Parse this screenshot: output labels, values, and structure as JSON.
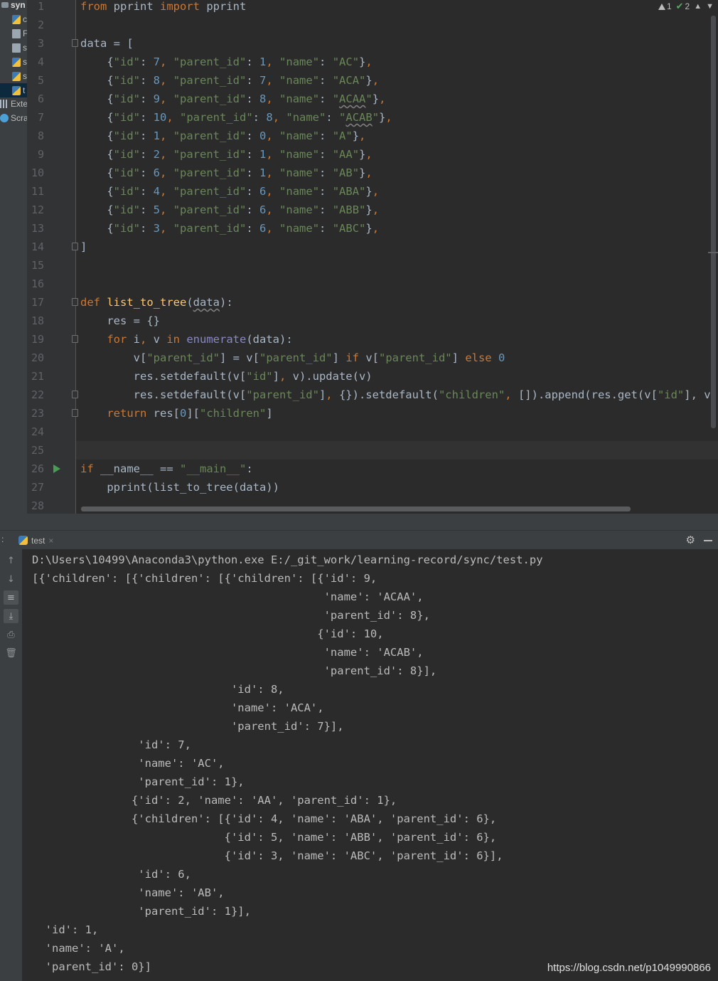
{
  "project_tree": {
    "root_label": "syn",
    "items": [
      {
        "icon": "python-file-icon",
        "label": "c"
      },
      {
        "icon": "file-icon",
        "label": "F"
      },
      {
        "icon": "file-icon",
        "label": "s"
      },
      {
        "icon": "python-file-icon",
        "label": "s"
      },
      {
        "icon": "python-file-icon",
        "label": "s"
      },
      {
        "icon": "python-file-icon",
        "label": "t"
      }
    ],
    "external_label": "Exte",
    "scratches_label": "Scra"
  },
  "editor": {
    "inspection": {
      "warnings": "1",
      "ok": "2"
    },
    "line_numbers": [
      "1",
      "2",
      "3",
      "4",
      "5",
      "6",
      "7",
      "8",
      "9",
      "10",
      "11",
      "12",
      "13",
      "14",
      "15",
      "16",
      "17",
      "18",
      "19",
      "20",
      "21",
      "22",
      "23",
      "24",
      "25",
      "26",
      "27",
      "28"
    ],
    "lines": [
      [
        {
          "t": "kw",
          "s": "from"
        },
        {
          "t": "p",
          "s": " pprint "
        },
        {
          "t": "kw",
          "s": "import"
        },
        {
          "t": "p",
          "s": " pprint"
        }
      ],
      [],
      [
        {
          "t": "p",
          "s": "data = ["
        }
      ],
      [
        {
          "t": "p",
          "s": "    {"
        },
        {
          "t": "str",
          "s": "\"id\""
        },
        {
          "t": "p",
          "s": ": "
        },
        {
          "t": "num",
          "s": "7"
        },
        {
          "t": "kw",
          "s": ", "
        },
        {
          "t": "str",
          "s": "\"parent_id\""
        },
        {
          "t": "p",
          "s": ": "
        },
        {
          "t": "num",
          "s": "1"
        },
        {
          "t": "kw",
          "s": ", "
        },
        {
          "t": "str",
          "s": "\"name\""
        },
        {
          "t": "p",
          "s": ": "
        },
        {
          "t": "str",
          "s": "\"AC\""
        },
        {
          "t": "p",
          "s": "}"
        },
        {
          "t": "kw",
          "s": ","
        }
      ],
      [
        {
          "t": "p",
          "s": "    {"
        },
        {
          "t": "str",
          "s": "\"id\""
        },
        {
          "t": "p",
          "s": ": "
        },
        {
          "t": "num",
          "s": "8"
        },
        {
          "t": "kw",
          "s": ", "
        },
        {
          "t": "str",
          "s": "\"parent_id\""
        },
        {
          "t": "p",
          "s": ": "
        },
        {
          "t": "num",
          "s": "7"
        },
        {
          "t": "kw",
          "s": ", "
        },
        {
          "t": "str",
          "s": "\"name\""
        },
        {
          "t": "p",
          "s": ": "
        },
        {
          "t": "str",
          "s": "\"ACA\""
        },
        {
          "t": "p",
          "s": "}"
        },
        {
          "t": "kw",
          "s": ","
        }
      ],
      [
        {
          "t": "p",
          "s": "    {"
        },
        {
          "t": "str",
          "s": "\"id\""
        },
        {
          "t": "p",
          "s": ": "
        },
        {
          "t": "num",
          "s": "9"
        },
        {
          "t": "kw",
          "s": ", "
        },
        {
          "t": "str",
          "s": "\"parent_id\""
        },
        {
          "t": "p",
          "s": ": "
        },
        {
          "t": "num",
          "s": "8"
        },
        {
          "t": "kw",
          "s": ", "
        },
        {
          "t": "str",
          "s": "\"name\""
        },
        {
          "t": "p",
          "s": ": "
        },
        {
          "t": "str",
          "s": "\""
        },
        {
          "t": "strsq",
          "s": "ACAA"
        },
        {
          "t": "str",
          "s": "\""
        },
        {
          "t": "p",
          "s": "}"
        },
        {
          "t": "kw",
          "s": ","
        }
      ],
      [
        {
          "t": "p",
          "s": "    {"
        },
        {
          "t": "str",
          "s": "\"id\""
        },
        {
          "t": "p",
          "s": ": "
        },
        {
          "t": "num",
          "s": "10"
        },
        {
          "t": "kw",
          "s": ", "
        },
        {
          "t": "str",
          "s": "\"parent_id\""
        },
        {
          "t": "p",
          "s": ": "
        },
        {
          "t": "num",
          "s": "8"
        },
        {
          "t": "kw",
          "s": ", "
        },
        {
          "t": "str",
          "s": "\"name\""
        },
        {
          "t": "p",
          "s": ": "
        },
        {
          "t": "str",
          "s": "\""
        },
        {
          "t": "strsq",
          "s": "ACAB"
        },
        {
          "t": "str",
          "s": "\""
        },
        {
          "t": "p",
          "s": "}"
        },
        {
          "t": "kw",
          "s": ","
        }
      ],
      [
        {
          "t": "p",
          "s": "    {"
        },
        {
          "t": "str",
          "s": "\"id\""
        },
        {
          "t": "p",
          "s": ": "
        },
        {
          "t": "num",
          "s": "1"
        },
        {
          "t": "kw",
          "s": ", "
        },
        {
          "t": "str",
          "s": "\"parent_id\""
        },
        {
          "t": "p",
          "s": ": "
        },
        {
          "t": "num",
          "s": "0"
        },
        {
          "t": "kw",
          "s": ", "
        },
        {
          "t": "str",
          "s": "\"name\""
        },
        {
          "t": "p",
          "s": ": "
        },
        {
          "t": "str",
          "s": "\"A\""
        },
        {
          "t": "p",
          "s": "}"
        },
        {
          "t": "kw",
          "s": ","
        }
      ],
      [
        {
          "t": "p",
          "s": "    {"
        },
        {
          "t": "str",
          "s": "\"id\""
        },
        {
          "t": "p",
          "s": ": "
        },
        {
          "t": "num",
          "s": "2"
        },
        {
          "t": "kw",
          "s": ", "
        },
        {
          "t": "str",
          "s": "\"parent_id\""
        },
        {
          "t": "p",
          "s": ": "
        },
        {
          "t": "num",
          "s": "1"
        },
        {
          "t": "kw",
          "s": ", "
        },
        {
          "t": "str",
          "s": "\"name\""
        },
        {
          "t": "p",
          "s": ": "
        },
        {
          "t": "str",
          "s": "\"AA\""
        },
        {
          "t": "p",
          "s": "}"
        },
        {
          "t": "kw",
          "s": ","
        }
      ],
      [
        {
          "t": "p",
          "s": "    {"
        },
        {
          "t": "str",
          "s": "\"id\""
        },
        {
          "t": "p",
          "s": ": "
        },
        {
          "t": "num",
          "s": "6"
        },
        {
          "t": "kw",
          "s": ", "
        },
        {
          "t": "str",
          "s": "\"parent_id\""
        },
        {
          "t": "p",
          "s": ": "
        },
        {
          "t": "num",
          "s": "1"
        },
        {
          "t": "kw",
          "s": ", "
        },
        {
          "t": "str",
          "s": "\"name\""
        },
        {
          "t": "p",
          "s": ": "
        },
        {
          "t": "str",
          "s": "\"AB\""
        },
        {
          "t": "p",
          "s": "}"
        },
        {
          "t": "kw",
          "s": ","
        }
      ],
      [
        {
          "t": "p",
          "s": "    {"
        },
        {
          "t": "str",
          "s": "\"id\""
        },
        {
          "t": "p",
          "s": ": "
        },
        {
          "t": "num",
          "s": "4"
        },
        {
          "t": "kw",
          "s": ", "
        },
        {
          "t": "str",
          "s": "\"parent_id\""
        },
        {
          "t": "p",
          "s": ": "
        },
        {
          "t": "num",
          "s": "6"
        },
        {
          "t": "kw",
          "s": ", "
        },
        {
          "t": "str",
          "s": "\"name\""
        },
        {
          "t": "p",
          "s": ": "
        },
        {
          "t": "str",
          "s": "\"ABA\""
        },
        {
          "t": "p",
          "s": "}"
        },
        {
          "t": "kw",
          "s": ","
        }
      ],
      [
        {
          "t": "p",
          "s": "    {"
        },
        {
          "t": "str",
          "s": "\"id\""
        },
        {
          "t": "p",
          "s": ": "
        },
        {
          "t": "num",
          "s": "5"
        },
        {
          "t": "kw",
          "s": ", "
        },
        {
          "t": "str",
          "s": "\"parent_id\""
        },
        {
          "t": "p",
          "s": ": "
        },
        {
          "t": "num",
          "s": "6"
        },
        {
          "t": "kw",
          "s": ", "
        },
        {
          "t": "str",
          "s": "\"name\""
        },
        {
          "t": "p",
          "s": ": "
        },
        {
          "t": "str",
          "s": "\"ABB\""
        },
        {
          "t": "p",
          "s": "}"
        },
        {
          "t": "kw",
          "s": ","
        }
      ],
      [
        {
          "t": "p",
          "s": "    {"
        },
        {
          "t": "str",
          "s": "\"id\""
        },
        {
          "t": "p",
          "s": ": "
        },
        {
          "t": "num",
          "s": "3"
        },
        {
          "t": "kw",
          "s": ", "
        },
        {
          "t": "str",
          "s": "\"parent_id\""
        },
        {
          "t": "p",
          "s": ": "
        },
        {
          "t": "num",
          "s": "6"
        },
        {
          "t": "kw",
          "s": ", "
        },
        {
          "t": "str",
          "s": "\"name\""
        },
        {
          "t": "p",
          "s": ": "
        },
        {
          "t": "str",
          "s": "\"ABC\""
        },
        {
          "t": "p",
          "s": "}"
        },
        {
          "t": "kw",
          "s": ","
        }
      ],
      [
        {
          "t": "p",
          "s": "]"
        }
      ],
      [],
      [],
      [
        {
          "t": "kw",
          "s": "def "
        },
        {
          "t": "fn",
          "s": "list_to_tree"
        },
        {
          "t": "p",
          "s": "("
        },
        {
          "t": "sq",
          "s": "data"
        },
        {
          "t": "p",
          "s": "):"
        }
      ],
      [
        {
          "t": "p",
          "s": "    res = {}"
        }
      ],
      [
        {
          "t": "p",
          "s": "    "
        },
        {
          "t": "kw",
          "s": "for"
        },
        {
          "t": "p",
          "s": " i"
        },
        {
          "t": "kw",
          "s": ","
        },
        {
          "t": "p",
          "s": " v "
        },
        {
          "t": "kw",
          "s": "in "
        },
        {
          "t": "bi",
          "s": "enumerate"
        },
        {
          "t": "p",
          "s": "(data):"
        }
      ],
      [
        {
          "t": "p",
          "s": "        v["
        },
        {
          "t": "str",
          "s": "\"parent_id\""
        },
        {
          "t": "p",
          "s": "] = v["
        },
        {
          "t": "str",
          "s": "\"parent_id\""
        },
        {
          "t": "p",
          "s": "] "
        },
        {
          "t": "kw",
          "s": "if"
        },
        {
          "t": "p",
          "s": " v["
        },
        {
          "t": "str",
          "s": "\"parent_id\""
        },
        {
          "t": "p",
          "s": "] "
        },
        {
          "t": "kw",
          "s": "else "
        },
        {
          "t": "num",
          "s": "0"
        }
      ],
      [
        {
          "t": "p",
          "s": "        res.setdefault(v["
        },
        {
          "t": "str",
          "s": "\"id\""
        },
        {
          "t": "p",
          "s": "]"
        },
        {
          "t": "kw",
          "s": ","
        },
        {
          "t": "p",
          "s": " v).update(v)"
        }
      ],
      [
        {
          "t": "p",
          "s": "        res.setdefault(v["
        },
        {
          "t": "str",
          "s": "\"parent_id\""
        },
        {
          "t": "p",
          "s": "]"
        },
        {
          "t": "kw",
          "s": ","
        },
        {
          "t": "p",
          "s": " {}).setdefault("
        },
        {
          "t": "str",
          "s": "\"children\""
        },
        {
          "t": "kw",
          "s": ","
        },
        {
          "t": "p",
          "s": " []).append(res.get(v["
        },
        {
          "t": "str",
          "s": "\"id\""
        },
        {
          "t": "p",
          "s": "], v))"
        }
      ],
      [
        {
          "t": "p",
          "s": "    "
        },
        {
          "t": "kw",
          "s": "return"
        },
        {
          "t": "p",
          "s": " res["
        },
        {
          "t": "num",
          "s": "0"
        },
        {
          "t": "p",
          "s": "]["
        },
        {
          "t": "str",
          "s": "\"children\""
        },
        {
          "t": "p",
          "s": "]"
        }
      ],
      [],
      [],
      [
        {
          "t": "kw",
          "s": "if"
        },
        {
          "t": "p",
          "s": " __name__ == "
        },
        {
          "t": "str",
          "s": "\"__main__\""
        },
        {
          "t": "p",
          "s": ":"
        }
      ],
      [
        {
          "t": "p",
          "s": "    pprint(list_to_tree(data))"
        }
      ],
      []
    ]
  },
  "run_panel": {
    "colon": ":",
    "tab_label": "test",
    "tab_close": "×",
    "settings_glyph": "⚙",
    "output_lines": [
      "D:\\Users\\10499\\Anaconda3\\python.exe E:/_git_work/learning-record/sync/test.py",
      "[{'children': [{'children': [{'children': [{'id': 9,",
      "                                            'name': 'ACAA',",
      "                                            'parent_id': 8},",
      "                                           {'id': 10,",
      "                                            'name': 'ACAB',",
      "                                            'parent_id': 8}],",
      "                              'id': 8,",
      "                              'name': 'ACA',",
      "                              'parent_id': 7}],",
      "                'id': 7,",
      "                'name': 'AC',",
      "                'parent_id': 1},",
      "               {'id': 2, 'name': 'AA', 'parent_id': 1},",
      "               {'children': [{'id': 4, 'name': 'ABA', 'parent_id': 6},",
      "                             {'id': 5, 'name': 'ABB', 'parent_id': 6},",
      "                             {'id': 3, 'name': 'ABC', 'parent_id': 6}],",
      "                'id': 6,",
      "                'name': 'AB',",
      "                'parent_id': 1}],",
      "  'id': 1,",
      "  'name': 'A',",
      "  'parent_id': 0}]"
    ]
  },
  "watermark": "https://blog.csdn.net/p1049990866",
  "colors": {
    "keyword": "#cc7832",
    "string": "#6a8759",
    "number": "#6897bb",
    "function": "#ffc66d",
    "builtin": "#8888c6",
    "plain": "#a9b7c6",
    "background": "#2b2b2b",
    "run_icon": "#499c54"
  }
}
